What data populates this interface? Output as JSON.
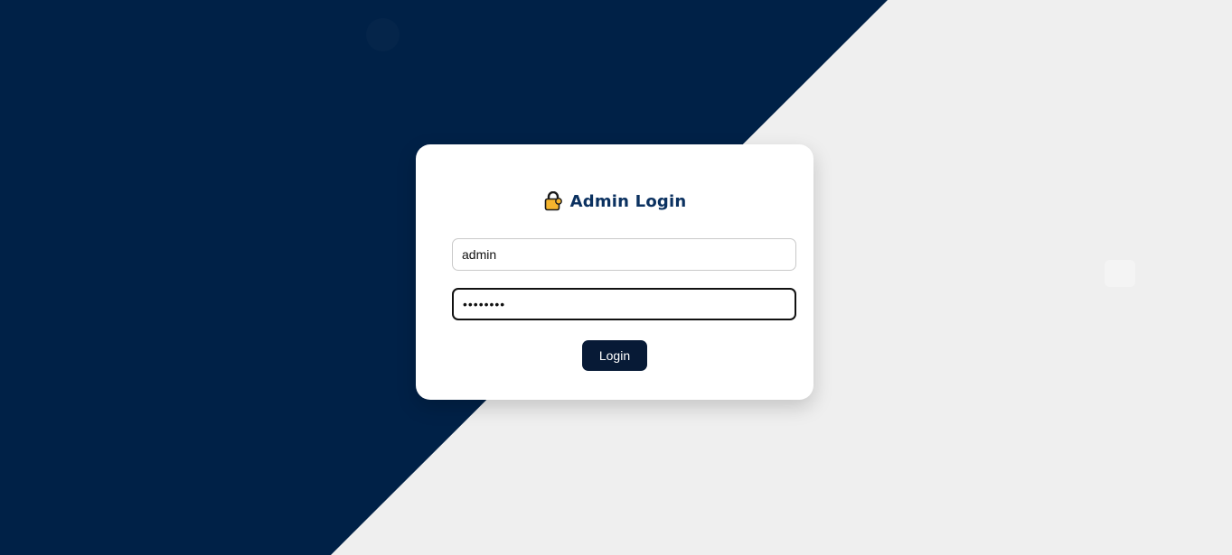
{
  "login": {
    "title": "Admin Login",
    "title_icon": "lock-icon",
    "username_value": "admin",
    "password_value": "••••••••",
    "button_label": "Login"
  },
  "colors": {
    "background_dark": "#002147",
    "background_light": "#efefef",
    "title_text": "#0b3160",
    "button": "#071a36",
    "lock_body": "#f5b52e"
  }
}
